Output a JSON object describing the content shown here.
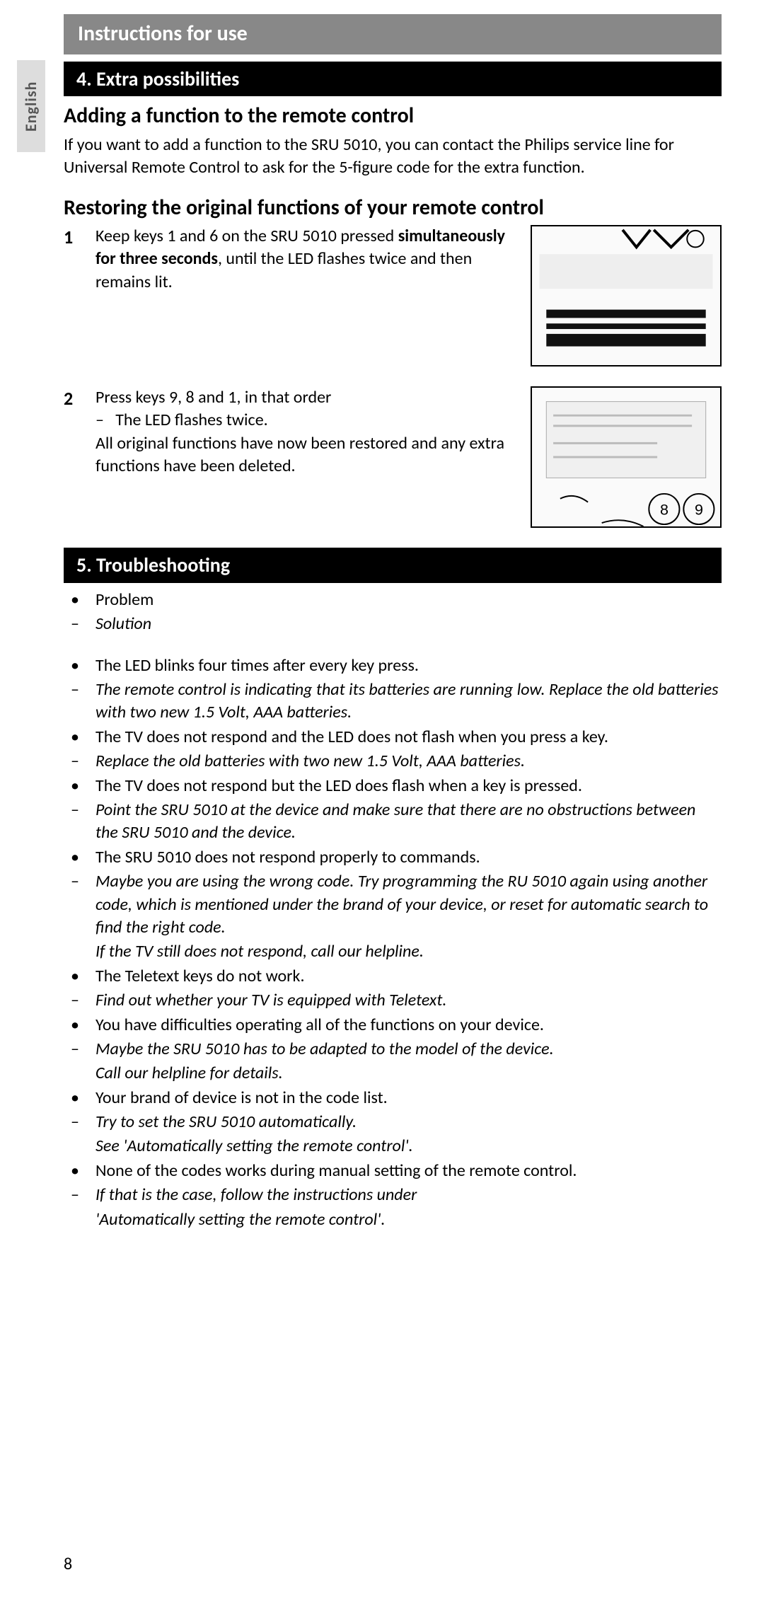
{
  "header": "Instructions for use",
  "lang_tab": "English",
  "section4": {
    "title": "4. Extra possibilities",
    "sub1": "Adding a function to the remote control",
    "para1": "If you want to add a function to the SRU 5010, you can contact the Philips service line for Universal Remote Control to ask for the 5-figure code for the extra function.",
    "sub2": "Restoring the original functions of your remote control",
    "steps": [
      {
        "num": "1",
        "text_a": "Keep keys 1 and 6 on the SRU 5010 pressed ",
        "text_bold": "simultaneously for three seconds",
        "text_b": ", until the LED flashes twice and then remains lit."
      },
      {
        "num": "2",
        "text_a": "Press keys 9, 8 and 1, in that order",
        "dash1": "The LED flashes twice.",
        "text_b": "All original functions have now been restored and any extra functions have been deleted."
      }
    ]
  },
  "section5": {
    "title": "5. Troubleshooting",
    "legend_problem": "Problem",
    "legend_solution": "Solution",
    "items": [
      {
        "problem": "The LED blinks four times after every key press.",
        "solution": "The remote control is indicating that its batteries are running low. Replace the old batteries with two new 1.5 Volt, AAA batteries."
      },
      {
        "problem": "The TV does not respond and the LED does not flash when you press a key.",
        "solution": "Replace the old batteries with two new 1.5 Volt, AAA batteries."
      },
      {
        "problem": "The TV does not respond but the LED does flash when a key is pressed.",
        "solution": "Point the SRU 5010 at the device and make sure that there are no obstructions between the SRU 5010 and the device."
      },
      {
        "problem": "The SRU 5010 does not respond properly to commands.",
        "solution": "Maybe you are using the wrong code. Try programming the RU 5010 again using another code, which is mentioned under the brand of your device, or reset for automatic search to find the right code.",
        "extra": "If the TV still does not respond, call our helpline."
      },
      {
        "problem": "The Teletext keys do not work.",
        "solution": "Find out whether your TV is equipped with Teletext."
      },
      {
        "problem": "You have difficulties operating all of the functions on your device.",
        "solution": "Maybe the SRU 5010 has to be adapted to the model of the device.",
        "extra": "Call our helpline for details."
      },
      {
        "problem": "Your brand of device is not in the code list.",
        "solution": "Try to set the SRU 5010 automatically.",
        "extra": "See 'Automatically setting the remote control'."
      },
      {
        "problem": "None of the codes works during manual setting of the remote control.",
        "solution": "If that is the case, follow the instructions under",
        "extra": "'Automatically setting the remote control'."
      }
    ]
  },
  "page_number": "8"
}
